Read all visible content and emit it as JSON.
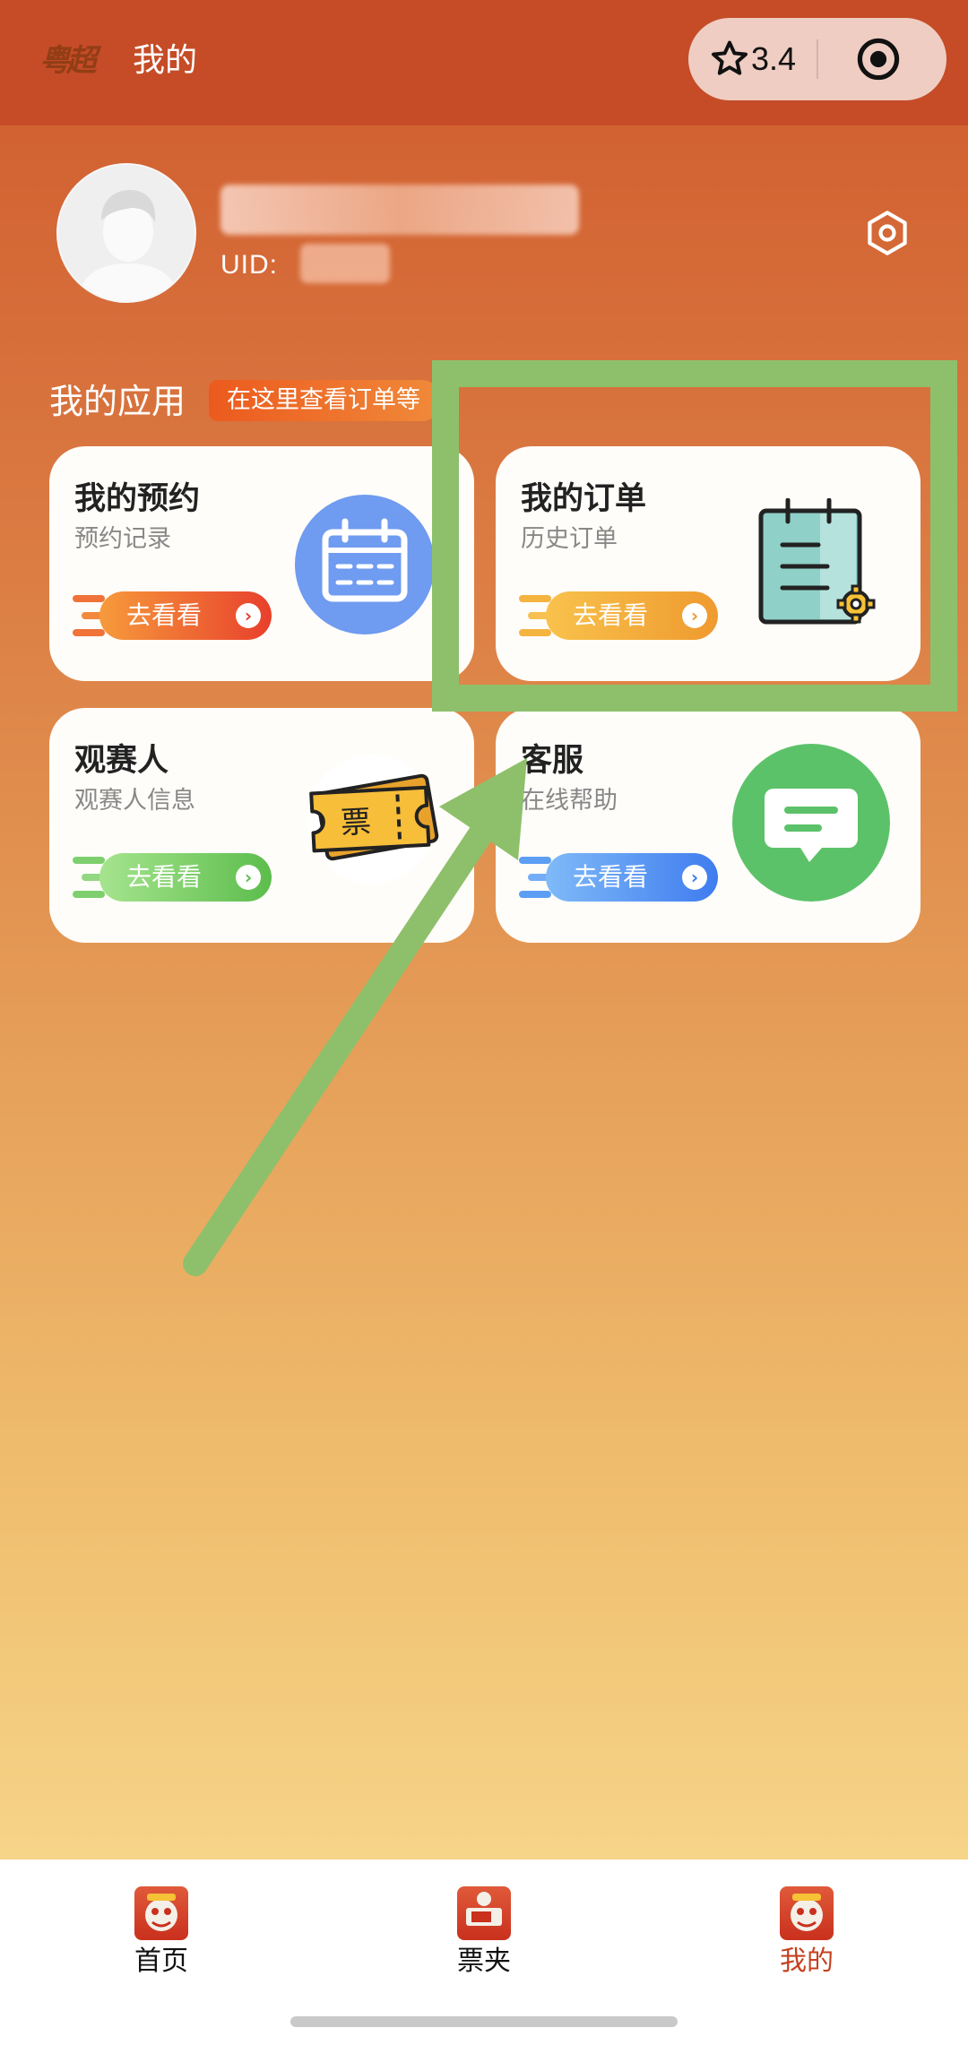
{
  "header": {
    "logo_text": "粤超",
    "title": "我的",
    "rating": "3.4"
  },
  "profile": {
    "uid_label": "UID:"
  },
  "apps": {
    "section_title": "我的应用",
    "tag": "在这里查看订单等",
    "go_label": "去看看",
    "items": [
      {
        "title": "我的预约",
        "subtitle": "预约记录",
        "icon": "calendar-icon",
        "color": "#6f9bf0"
      },
      {
        "title": "我的订单",
        "subtitle": "历史订单",
        "icon": "order-notebook-icon",
        "color": "#f2a43a"
      },
      {
        "title": "观赛人",
        "subtitle": "观赛人信息",
        "icon": "ticket-icon",
        "ticket_text": "票",
        "color": "#68c659"
      },
      {
        "title": "客服",
        "subtitle": "在线帮助",
        "icon": "chat-bubble-icon",
        "color": "#4c8cf5"
      }
    ]
  },
  "tabbar": {
    "items": [
      {
        "label": "首页",
        "active": false
      },
      {
        "label": "票夹",
        "active": false
      },
      {
        "label": "我的",
        "active": true
      }
    ]
  },
  "colors": {
    "header_bg": "#c54c27",
    "highlight": "#8ec06c",
    "active_tab": "#c6411f"
  }
}
